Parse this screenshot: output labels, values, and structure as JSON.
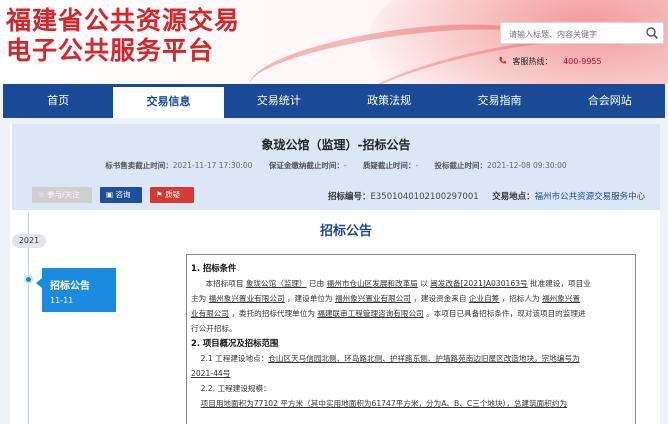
{
  "header": {
    "title_line1": "福建省公共资源交易",
    "title_line2": "电子公共服务平台",
    "search_placeholder": "请输入标题、内容关键字",
    "hotline_label": "客服热线：",
    "hotline_number": "400-9955"
  },
  "nav": {
    "items": [
      "首页",
      "交易信息",
      "交易统计",
      "政策法规",
      "交易指南",
      "合会网站"
    ],
    "active_index": 1
  },
  "announcement": {
    "title": "象珑公馆（监理）-招标公告",
    "dates": [
      {
        "label": "标书售卖截止时间：",
        "value": "2021-11-17 17:30:00"
      },
      {
        "label": "保证金缴纳截止时间：",
        "value": "-"
      },
      {
        "label": "质疑截止时间：",
        "value": "-"
      },
      {
        "label": "投标截止时间：",
        "value": "2021-12-08 09:30:00"
      }
    ],
    "buttons": {
      "follow": "☆ 参与/关注",
      "consult": "咨询",
      "report": "质疑"
    },
    "code_label": "招标编号：",
    "code_value": "E3501040102100297001",
    "place_label": "交易地点：",
    "place_value": "福州市公共资源交易服务中心"
  },
  "timeline": {
    "year": "2021",
    "card_title": "招标公告",
    "card_date": "11-11"
  },
  "section_title": "招标公告",
  "doc": {
    "s1_title": "1. 招标条件",
    "s1_p1_a": "本招标项目",
    "s1_p1_b": "象珑公馆（监理）",
    "s1_p1_c": "已由",
    "s1_p1_d": "福州市仓山区发展和改革局",
    "s1_p1_e": "以",
    "s1_p1_f": "闽发改备[2021]A030163号",
    "s1_p1_g": "批准建设，项目业",
    "s1_p2_a": "主为",
    "s1_p2_b": "福州象兴置业有限公司",
    "s1_p2_c": "，建设单位为",
    "s1_p2_d": "福州象兴置业有限公司",
    "s1_p2_e": "，建设资金来自",
    "s1_p2_f": "企业自筹",
    "s1_p2_g": "，招标人为",
    "s1_p2_h": "福州象兴置",
    "s1_p3_a": "业有限公司",
    "s1_p3_b": "，委托的招标代理单位为",
    "s1_p3_c": "福建联审工程管理咨询有限公司",
    "s1_p3_d": "。本项目已具备招标条件，现对该项目的监理进",
    "s1_p4": "行公开招标。",
    "s2_title": "2. 项目概况及招标范围",
    "s2_1_a": "2.1 工程建设地点：",
    "s2_1_b": "仓山区天马信园北侧、环岛路北侧、护祥路东侧、护墙路苑南边旧屋区改造地块，宗地编号为",
    "s2_1_c": "2021-44号",
    "s2_2": "2.2. 工程建设规模：",
    "s2_3": "项目用地面积为77102 平方米（其中实用地面积为61747平方米，分为A、B、C三个地块），总建筑面积约为"
  }
}
